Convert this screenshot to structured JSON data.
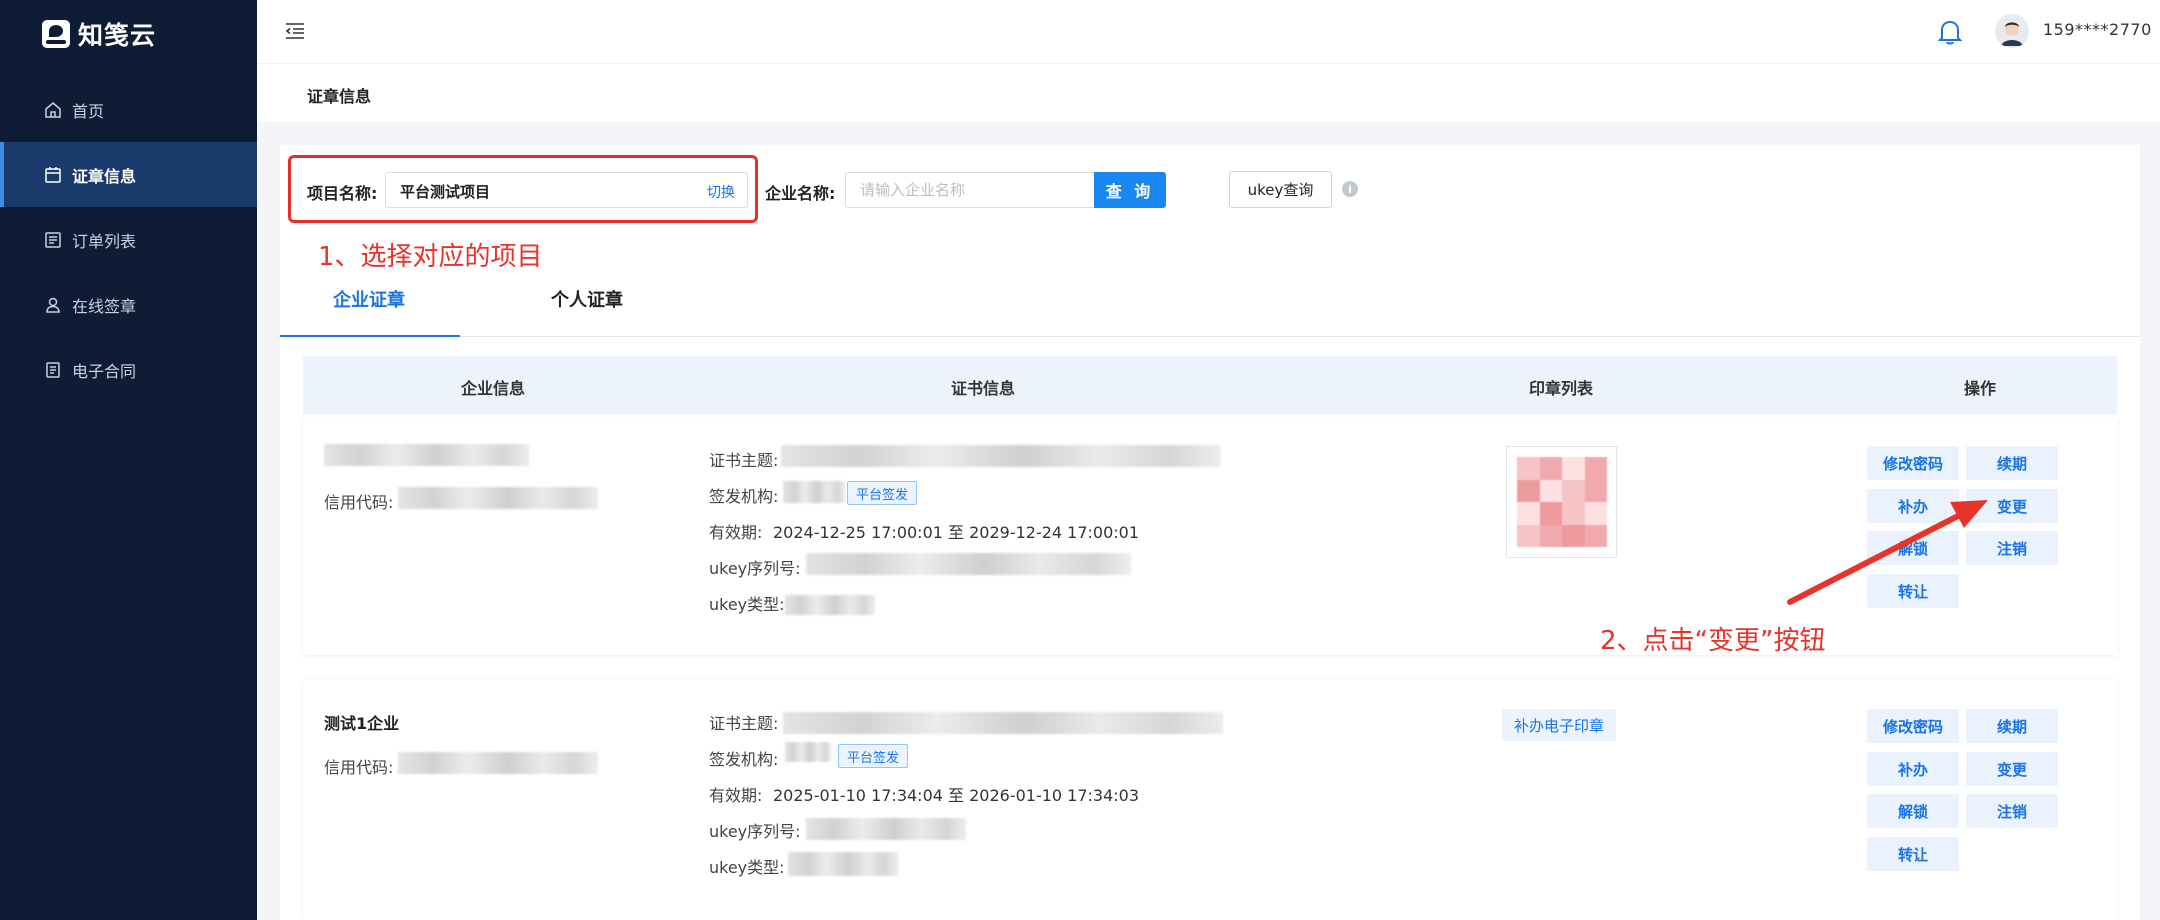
{
  "app": {
    "logo_text": "知笺云"
  },
  "sidebar": {
    "items": [
      {
        "label": "首页",
        "icon": "home-icon"
      },
      {
        "label": "证章信息",
        "icon": "calendar-icon",
        "active": true
      },
      {
        "label": "订单列表",
        "icon": "list-icon"
      },
      {
        "label": "在线签章",
        "icon": "user-stamp-icon"
      },
      {
        "label": "电子合同",
        "icon": "document-icon"
      }
    ]
  },
  "header": {
    "user_phone": "159****2770"
  },
  "breadcrumb": {
    "title": "证章信息"
  },
  "filters": {
    "project_label": "项目名称:",
    "project_value": "平台测试项目",
    "switch_label": "切换",
    "company_label": "企业名称:",
    "company_placeholder": "请输入企业名称",
    "query_label": "查 询",
    "ukey_query_label": "ukey查询"
  },
  "annotations": {
    "step1": "1、选择对应的项目",
    "step2": "2、点击“变更”按钮"
  },
  "tabs": [
    {
      "label": "企业证章",
      "active": true
    },
    {
      "label": "个人证章"
    }
  ],
  "table": {
    "headers": [
      "企业信息",
      "证书信息",
      "印章列表",
      "操作"
    ],
    "rows": [
      {
        "company_name": "",
        "credit_code_label": "信用代码:",
        "cert_subject_label": "证书主题:",
        "issuer_label": "签发机构:",
        "issuer_tag": "平台签发",
        "validity_label": "有效期:",
        "validity_value": "2024-12-25 17:00:01 至 2029-12-24 17:00:01",
        "ukey_serial_label": "ukey序列号:",
        "ukey_type_label": "ukey类型:",
        "seal": "image",
        "actions": [
          "修改密码",
          "续期",
          "补办",
          "变更",
          "解锁",
          "注销",
          "转让"
        ]
      },
      {
        "company_name": "测试1企业",
        "credit_code_label": "信用代码:",
        "cert_subject_label": "证书主题:",
        "issuer_label": "签发机构:",
        "issuer_tag": "平台签发",
        "validity_label": "有效期:",
        "validity_value": "2025-01-10 17:34:04 至 2026-01-10 17:34:03",
        "ukey_serial_label": "ukey序列号:",
        "ukey_type_label": "ukey类型:",
        "seal_button": "补办电子印章",
        "actions": [
          "修改密码",
          "续期",
          "补办",
          "变更",
          "解锁",
          "注销",
          "转让"
        ]
      }
    ]
  },
  "colors": {
    "accent": "#1a86f0",
    "sidebar_bg": "#0e1d35",
    "annotation": "#e8332a"
  }
}
